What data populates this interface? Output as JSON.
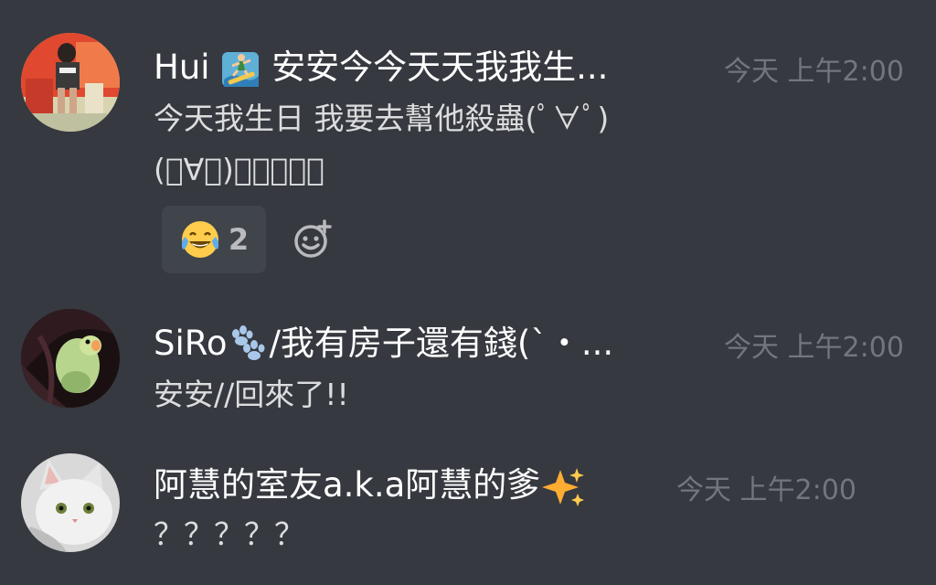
{
  "messages": [
    {
      "username_prefix": "Hui ",
      "username_suffix": " 安安今今天天我我生...",
      "username_icon": "surfer-emoji",
      "timestamp": "今天 上午2:00",
      "lines": [
        "今天我生日 我要去幫他殺蟲(ﾟ∀ﾟ)",
        "(ﾟ∀ﾟ)？？？？？"
      ],
      "reaction": {
        "emoji": "tears-of-joy-emoji",
        "count": "2"
      },
      "add_reaction_icon": "add-reaction-icon"
    },
    {
      "username_prefix": "SiRo",
      "username_suffix": "/我有房子還有錢(`・...",
      "username_icon": "paw-prints-emoji",
      "timestamp": "今天 上午2:00",
      "lines": [
        "安安//回來了!!"
      ]
    },
    {
      "username_prefix": "阿慧的室友a.k.a阿慧的爹",
      "username_suffix": "",
      "username_icon": "sparkles-emoji",
      "timestamp": "今天 上午2:00",
      "lines": [
        "？？？？？"
      ]
    }
  ],
  "colors": {
    "background": "#36393f",
    "username": "#ffffff",
    "message_text": "#dcddde",
    "timestamp": "#72767d",
    "reaction_bg": "#40444b",
    "reaction_count": "#b9bbbe"
  }
}
